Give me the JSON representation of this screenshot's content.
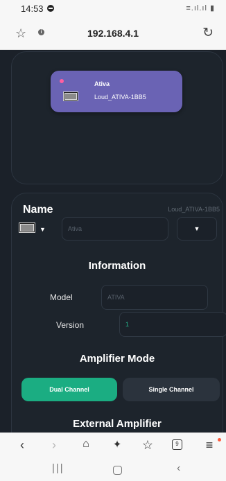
{
  "status_bar": {
    "time": "14:53",
    "signal": "≡.ıl.ıl ▮"
  },
  "url_bar": {
    "url": "192.168.4.1"
  },
  "device_card": {
    "title": "Ativa",
    "subtitle": "Loud_ATIVA-1BB5"
  },
  "name_section": {
    "title": "Name",
    "device_id": "Loud_ATIVA-1BB5",
    "name_value": "Ativa"
  },
  "information": {
    "title": "Information",
    "model_label": "Model",
    "model_value": "ATIVA",
    "version_label": "Version",
    "version_value": "1"
  },
  "amplifier_mode": {
    "title": "Amplifier Mode",
    "dual_label": "Dual Channel",
    "single_label": "Single Channel",
    "selected": "Dual Channel"
  },
  "external_amplifier": {
    "title": "External Amplifier"
  },
  "colors": {
    "page_bg": "#1b2129",
    "card": "#6a63b4",
    "accent": "#1bad82",
    "secondary_button": "#2b333d"
  },
  "browser_toolbar": {
    "tabs_count": "9"
  },
  "icons": [
    "star-icon",
    "info-icon",
    "reload-icon",
    "amplifier-icon",
    "caret-down-icon",
    "back-icon",
    "forward-icon",
    "home-icon",
    "sparkle-icon",
    "bookmark-star-icon",
    "tabs-icon",
    "menu-icon"
  ]
}
